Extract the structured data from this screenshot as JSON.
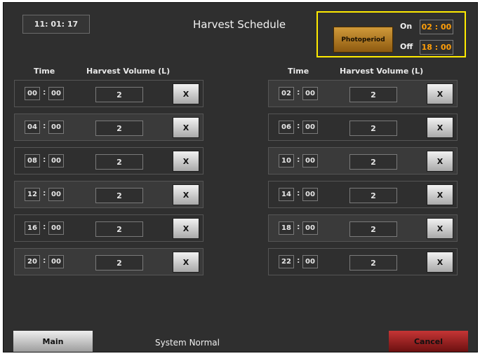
{
  "header": {
    "clock": "11: 01: 17",
    "title": "Harvest Schedule"
  },
  "photoperiod": {
    "button_label": "Photoperiod",
    "on_label": "On",
    "on_value": "02 : 00",
    "off_label": "Off",
    "off_value": "18 : 00",
    "highlight_color": "#ffeb00",
    "value_color": "#ff9f0a"
  },
  "columns": {
    "time": "Time",
    "volume": "Harvest Volume (L)"
  },
  "rows": [
    {
      "hour": "00",
      "minute": "00",
      "volume": "2",
      "delete_label": "X"
    },
    {
      "hour": "04",
      "minute": "00",
      "volume": "2",
      "delete_label": "X"
    },
    {
      "hour": "08",
      "minute": "00",
      "volume": "2",
      "delete_label": "X"
    },
    {
      "hour": "12",
      "minute": "00",
      "volume": "2",
      "delete_label": "X"
    },
    {
      "hour": "16",
      "minute": "00",
      "volume": "2",
      "delete_label": "X"
    },
    {
      "hour": "20",
      "minute": "00",
      "volume": "2",
      "delete_label": "X"
    },
    {
      "hour": "02",
      "minute": "00",
      "volume": "2",
      "delete_label": "X"
    },
    {
      "hour": "06",
      "minute": "00",
      "volume": "2",
      "delete_label": "X"
    },
    {
      "hour": "10",
      "minute": "00",
      "volume": "2",
      "delete_label": "X"
    },
    {
      "hour": "14",
      "minute": "00",
      "volume": "2",
      "delete_label": "X"
    },
    {
      "hour": "18",
      "minute": "00",
      "volume": "2",
      "delete_label": "X"
    },
    {
      "hour": "22",
      "minute": "00",
      "volume": "2",
      "delete_label": "X"
    }
  ],
  "footer": {
    "main_label": "Main",
    "status": "System Normal",
    "cancel_label": "Cancel"
  }
}
